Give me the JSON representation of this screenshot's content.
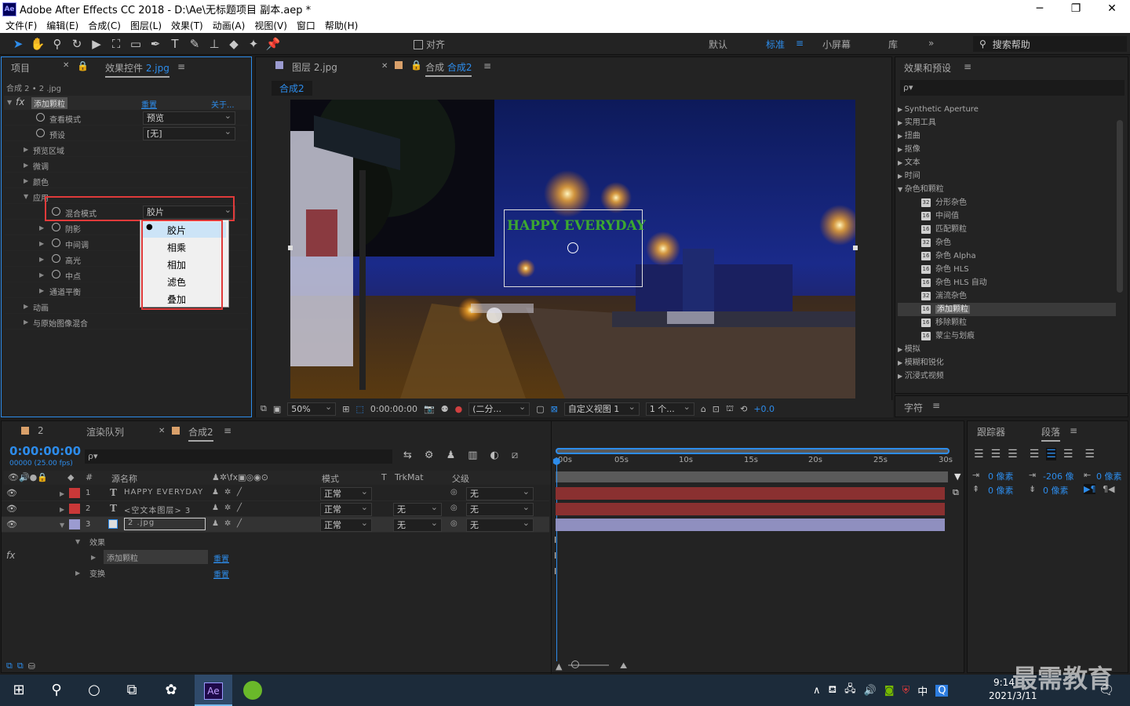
{
  "window": {
    "title": "Adobe After Effects CC 2018 - D:\\Ae\\无标题项目 副本.aep *",
    "logo": "Ae",
    "minimize": "─",
    "maximize": "❐",
    "close": "✕"
  },
  "menu": [
    "文件(F)",
    "编辑(E)",
    "合成(C)",
    "图层(L)",
    "效果(T)",
    "动画(A)",
    "视图(V)",
    "窗口",
    "帮助(H)"
  ],
  "toolbar": {
    "snap_label": "对齐",
    "workspaces": [
      "默认",
      "标准",
      "小屏幕",
      "库"
    ],
    "active_workspace": "标准",
    "search_placeholder": "搜索帮助",
    "more": "»"
  },
  "left_panel": {
    "tab_project": "项目",
    "tab_effect": "效果控件",
    "tab_effect_target": "2.jpg",
    "breadcrumb": "合成 2 • 2 .jpg",
    "fx_label": "fx",
    "effect_name": "添加颗粒",
    "reset": "重置",
    "about": "关于...",
    "rows": [
      {
        "label": "查看模式",
        "value": "预览"
      },
      {
        "label": "预设",
        "value": "[无]"
      },
      {
        "label": "预览区域"
      },
      {
        "label": "微调"
      },
      {
        "label": "颜色"
      },
      {
        "label": "应用"
      },
      {
        "label": "混合模式",
        "value": "胶片"
      },
      {
        "label": "阴影"
      },
      {
        "label": "中间调"
      },
      {
        "label": "高光"
      },
      {
        "label": "中点"
      },
      {
        "label": "通道平衡"
      },
      {
        "label": "动画"
      },
      {
        "label": "与原始图像混合"
      }
    ],
    "blend_menu": {
      "items": [
        "胶片",
        "相乘",
        "相加",
        "滤色",
        "叠加"
      ],
      "selected": "胶片"
    }
  },
  "viewer": {
    "tab_layer_prefix": "图层",
    "tab_layer_name": "2.jpg",
    "tab_comp_prefix": "合成",
    "tab_comp_name": "合成2",
    "comp_chip": "合成2",
    "overlay_text": "HAPPY EVERYDAY",
    "footer": {
      "zoom": "50%",
      "timecode": "0:00:00:00",
      "resolution": "(二分...",
      "view": "自定义视图 1",
      "views": "1 个...",
      "exposure": "+0.0"
    }
  },
  "effects_panel": {
    "title": "效果和预设",
    "search_placeholder": "ρ▾",
    "items": [
      {
        "label": "Synthetic Aperture",
        "type": "cat",
        "open": false
      },
      {
        "label": "实用工具",
        "type": "cat",
        "open": false
      },
      {
        "label": "扭曲",
        "type": "cat",
        "open": false
      },
      {
        "label": "抠像",
        "type": "cat",
        "open": false
      },
      {
        "label": "文本",
        "type": "cat",
        "open": false
      },
      {
        "label": "时间",
        "type": "cat",
        "open": false
      },
      {
        "label": "杂色和颗粒",
        "type": "cat",
        "open": true
      },
      {
        "label": "分形杂色",
        "type": "fx",
        "badge": "32"
      },
      {
        "label": "中间值",
        "type": "fx",
        "badge": "16"
      },
      {
        "label": "匹配颗粒",
        "type": "fx",
        "badge": "16"
      },
      {
        "label": "杂色",
        "type": "fx",
        "badge": "32"
      },
      {
        "label": "杂色 Alpha",
        "type": "fx",
        "badge": "16"
      },
      {
        "label": "杂色 HLS",
        "type": "fx",
        "badge": "16"
      },
      {
        "label": "杂色 HLS 自动",
        "type": "fx",
        "badge": "16"
      },
      {
        "label": "湍流杂色",
        "type": "fx",
        "badge": "32"
      },
      {
        "label": "添加颗粒",
        "type": "fx",
        "badge": "16",
        "selected": true
      },
      {
        "label": "移除颗粒",
        "type": "fx",
        "badge": "16"
      },
      {
        "label": "蒙尘与划痕",
        "type": "fx",
        "badge": "16"
      },
      {
        "label": "模拟",
        "type": "cat",
        "open": false
      },
      {
        "label": "模糊和锐化",
        "type": "cat",
        "open": false
      },
      {
        "label": "沉浸式视频",
        "type": "cat",
        "open": false
      }
    ]
  },
  "char_panel": {
    "title": "字符"
  },
  "para_panel": {
    "tab_tracker": "跟踪器",
    "tab_para": "段落",
    "indent_left": "0 像素",
    "indent_right": "0 像素",
    "first_line": "-206 像",
    "space_before": "0 像素",
    "space_after": "0 像素",
    "indent_first": "0 像素"
  },
  "timeline": {
    "tab_render_id": "2",
    "tab_render": "渲染队列",
    "tab_comp": "合成2",
    "timecode": "0:00:00:00",
    "fps": "00000 (25.00 fps)",
    "search_placeholder": "ρ▾",
    "col_name": "源名称",
    "col_mode": "模式",
    "col_t": "T",
    "col_trkmat": "TrkMat",
    "col_parent": "父级",
    "col_num": "#",
    "ruler": [
      "00s",
      "05s",
      "10s",
      "15s",
      "20s",
      "25s",
      "30s"
    ],
    "layers": [
      {
        "num": "1",
        "type": "T",
        "name": "HAPPY EVERYDAY",
        "mode": "正常",
        "trkmat": "",
        "parent": "无",
        "color": "#c93838"
      },
      {
        "num": "2",
        "type": "T",
        "name": "<空文本图层> 3",
        "mode": "正常",
        "trkmat": "无",
        "parent": "无",
        "color": "#c93838"
      },
      {
        "num": "3",
        "type": "img",
        "name": "2 .jpg",
        "mode": "正常",
        "trkmat": "无",
        "parent": "无",
        "color": "#9b9bd0"
      }
    ],
    "sub_effects": "效果",
    "sub_effect_name": "添加颗粒",
    "sub_reset": "重置",
    "sub_transform": "变换",
    "sub_transform_reset": "重置"
  },
  "taskbar": {
    "time": "9:14",
    "date": "2021/3/11",
    "ime": "中",
    "watermark": "最需教育"
  }
}
